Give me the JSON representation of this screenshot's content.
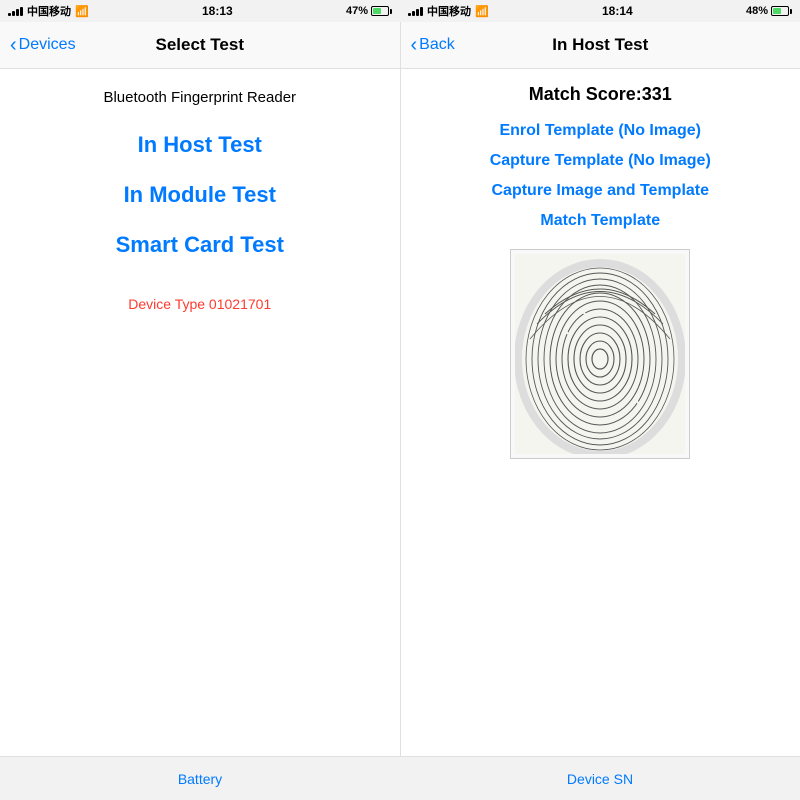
{
  "left_status": {
    "carrier": "中国移动",
    "time": "18:13",
    "battery_pct": "47%",
    "carrier2": "中国移动"
  },
  "right_status": {
    "time": "18:14",
    "battery_pct": "48%"
  },
  "left_nav": {
    "back_label": "Devices",
    "title": "Select Test"
  },
  "right_nav": {
    "back_label": "Back",
    "title": "In Host Test"
  },
  "left_panel": {
    "device_label": "Bluetooth Fingerprint Reader",
    "menu_items": [
      "In Host Test",
      "In Module Test",
      "Smart Card Test"
    ],
    "device_type_label": "Device Type   01021701"
  },
  "right_panel": {
    "match_score_label": "Match Score:331",
    "action_items": [
      "Enrol Template (No Image)",
      "Capture Template (No Image)",
      "Capture Image and Template",
      "Match Template"
    ]
  },
  "bottom_bar": {
    "battery_label": "Battery",
    "device_sn_label": "Device SN"
  }
}
